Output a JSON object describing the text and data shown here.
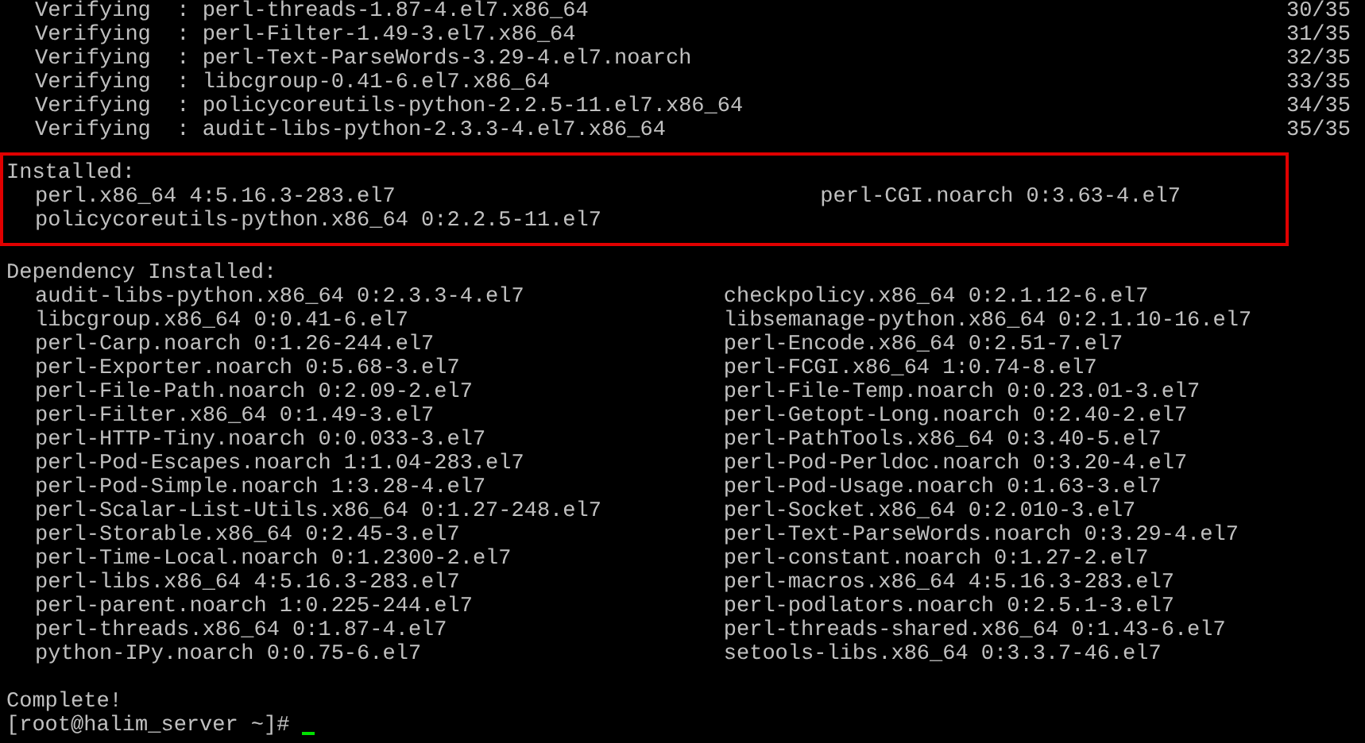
{
  "verify_lines": [
    {
      "text": "Verifying  : perl-threads-1.87-4.el7.x86_64",
      "progress": "30/35"
    },
    {
      "text": "Verifying  : perl-Filter-1.49-3.el7.x86_64",
      "progress": "31/35"
    },
    {
      "text": "Verifying  : perl-Text-ParseWords-3.29-4.el7.noarch",
      "progress": "32/35"
    },
    {
      "text": "Verifying  : libcgroup-0.41-6.el7.x86_64",
      "progress": "33/35"
    },
    {
      "text": "Verifying  : policycoreutils-python-2.2.5-11.el7.x86_64",
      "progress": "34/35"
    },
    {
      "text": "Verifying  : audit-libs-python-2.3.3-4.el7.x86_64",
      "progress": "35/35"
    }
  ],
  "installed": {
    "heading": "Installed:",
    "highlighted": true,
    "packages": [
      "perl.x86_64 4:5.16.3-283.el7",
      "perl-CGI.noarch 0:3.63-4.el7",
      "policycoreutils-python.x86_64 0:2.2.5-11.el7"
    ]
  },
  "dependency_installed": {
    "heading": "Dependency Installed:",
    "packages": [
      "audit-libs-python.x86_64 0:2.3.3-4.el7",
      "checkpolicy.x86_64 0:2.1.12-6.el7",
      "libcgroup.x86_64 0:0.41-6.el7",
      "libsemanage-python.x86_64 0:2.1.10-16.el7",
      "perl-Carp.noarch 0:1.26-244.el7",
      "perl-Encode.x86_64 0:2.51-7.el7",
      "perl-Exporter.noarch 0:5.68-3.el7",
      "perl-FCGI.x86_64 1:0.74-8.el7",
      "perl-File-Path.noarch 0:2.09-2.el7",
      "perl-File-Temp.noarch 0:0.23.01-3.el7",
      "perl-Filter.x86_64 0:1.49-3.el7",
      "perl-Getopt-Long.noarch 0:2.40-2.el7",
      "perl-HTTP-Tiny.noarch 0:0.033-3.el7",
      "perl-PathTools.x86_64 0:3.40-5.el7",
      "perl-Pod-Escapes.noarch 1:1.04-283.el7",
      "perl-Pod-Perldoc.noarch 0:3.20-4.el7",
      "perl-Pod-Simple.noarch 1:3.28-4.el7",
      "perl-Pod-Usage.noarch 0:1.63-3.el7",
      "perl-Scalar-List-Utils.x86_64 0:1.27-248.el7",
      "perl-Socket.x86_64 0:2.010-3.el7",
      "perl-Storable.x86_64 0:2.45-3.el7",
      "perl-Text-ParseWords.noarch 0:3.29-4.el7",
      "perl-Time-Local.noarch 0:1.2300-2.el7",
      "perl-constant.noarch 0:1.27-2.el7",
      "perl-libs.x86_64 4:5.16.3-283.el7",
      "perl-macros.x86_64 4:5.16.3-283.el7",
      "perl-parent.noarch 1:0.225-244.el7",
      "perl-podlators.noarch 0:2.5.1-3.el7",
      "perl-threads.x86_64 0:1.87-4.el7",
      "perl-threads-shared.x86_64 0:1.43-6.el7",
      "python-IPy.noarch 0:0.75-6.el7",
      "setools-libs.x86_64 0:3.3.7-46.el7"
    ]
  },
  "complete": "Complete!",
  "prompt": "[root@halim_server ~]#",
  "cursor_visible": true
}
